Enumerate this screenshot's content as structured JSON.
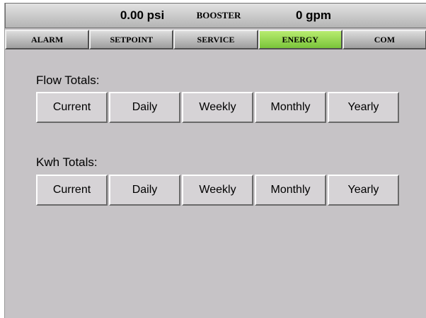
{
  "status": {
    "pressure": "0.00 psi",
    "mode": "BOOSTER",
    "flow": "0 gpm"
  },
  "tabs": [
    {
      "label": "ALARM",
      "active": false
    },
    {
      "label": "SETPOINT",
      "active": false
    },
    {
      "label": "SERVICE",
      "active": false
    },
    {
      "label": "ENERGY",
      "active": true
    },
    {
      "label": "COM",
      "active": false
    }
  ],
  "colors": {
    "active_tab": "#9ee05a",
    "background": "#c6c3c6"
  },
  "flow_totals": {
    "label": "Flow Totals:",
    "buttons": [
      "Current",
      "Daily",
      "Weekly",
      "Monthly",
      "Yearly"
    ]
  },
  "kwh_totals": {
    "label": "Kwh Totals:",
    "buttons": [
      "Current",
      "Daily",
      "Weekly",
      "Monthly",
      "Yearly"
    ]
  }
}
